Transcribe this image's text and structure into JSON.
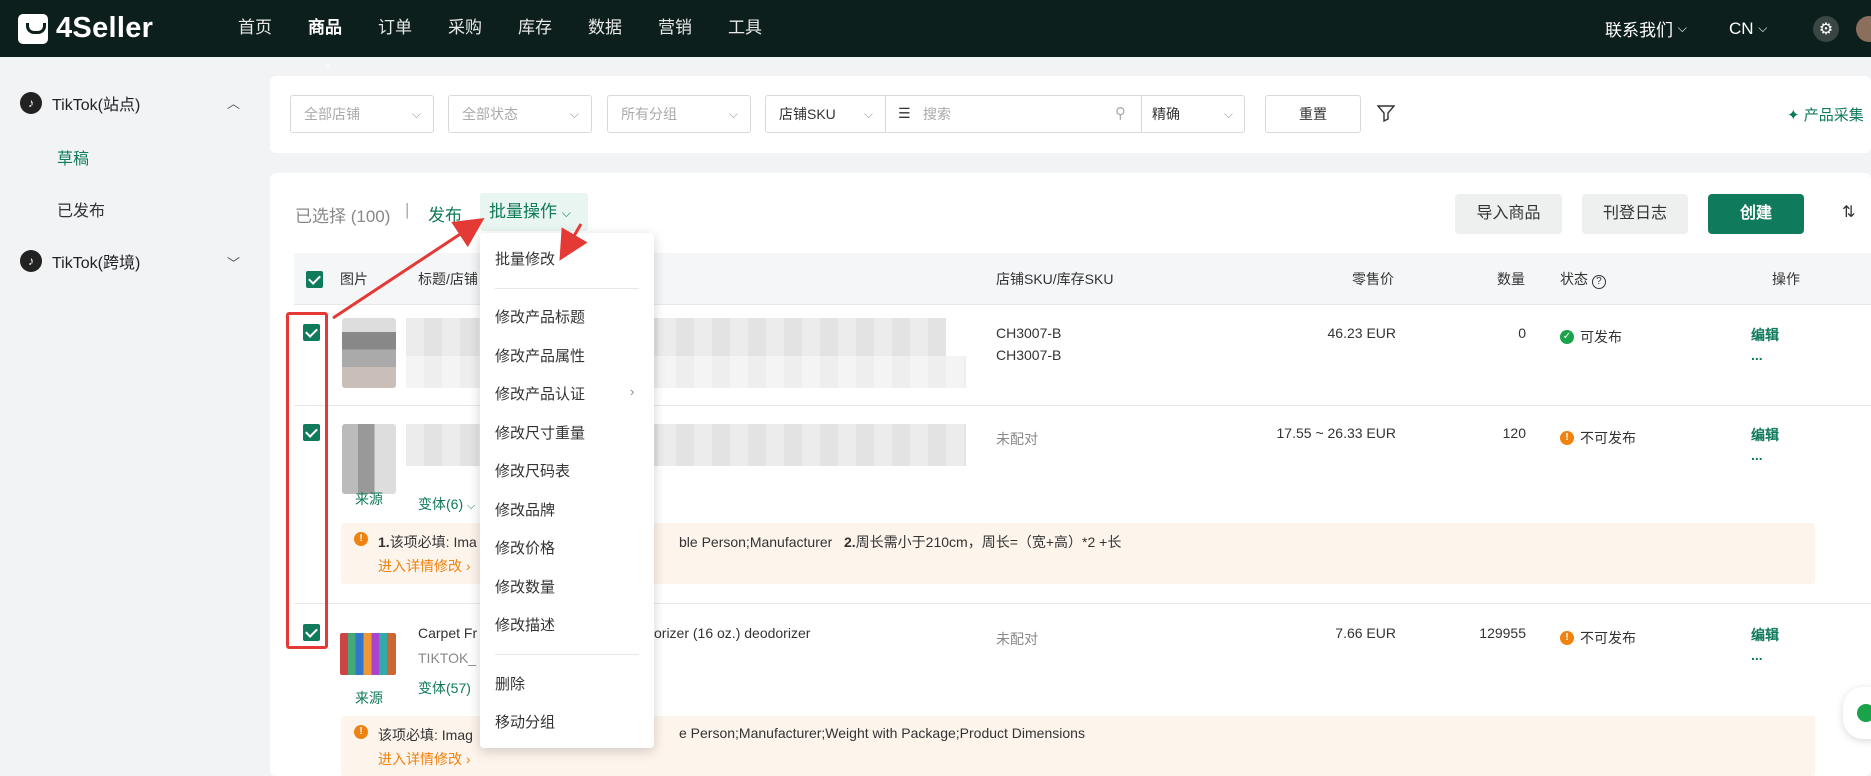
{
  "brand": {
    "name": "4Seller"
  },
  "nav": [
    {
      "label": "首页"
    },
    {
      "label": "商品"
    },
    {
      "label": "订单"
    },
    {
      "label": "采购"
    },
    {
      "label": "库存"
    },
    {
      "label": "数据"
    },
    {
      "label": "营销"
    },
    {
      "label": "工具"
    }
  ],
  "header": {
    "contact": "联系我们",
    "lang": "CN"
  },
  "sidebar": {
    "group1": "TikTok(站点)",
    "items": [
      {
        "label": "草稿"
      },
      {
        "label": "已发布"
      }
    ],
    "group2": "TikTok(跨境)"
  },
  "filters": {
    "store": "全部店铺",
    "status": "全部状态",
    "group": "所有分组",
    "sku_type": "店铺SKU",
    "search_placeholder": "搜索",
    "match": "精确",
    "reset": "重置",
    "collect": "产品采集"
  },
  "toolbar": {
    "selected": "已选择 (100)",
    "publish": "发布",
    "batch": "批量操作",
    "import": "导入商品",
    "log": "刊登日志",
    "create": "创建"
  },
  "table": {
    "headers": {
      "image": "图片",
      "title": "标题/店铺",
      "sku": "店铺SKU/库存SKU",
      "price": "零售价",
      "qty": "数量",
      "status": "状态",
      "action": "操作"
    },
    "rows": [
      {
        "sku1": "CH3007-B",
        "sku2": "CH3007-B",
        "price": "46.23 EUR",
        "qty": "0",
        "status": "可发布",
        "edit": "编辑",
        "more": "..."
      },
      {
        "sku1": "未配对",
        "price": "17.55 ~ 26.33 EUR",
        "qty": "120",
        "status": "不可发布",
        "edit": "编辑",
        "more": "...",
        "source": "来源",
        "variants": "变体(6)",
        "warning": {
          "num1": "1.",
          "part1": "该项必填: Ima",
          "part2": "ble Person;Manufacturer",
          "num2": "2.",
          "part3": "周长需小于210cm，周长=（宽+高）*2 +长",
          "link": "进入详情修改"
        }
      },
      {
        "title_a": "Carpet Fr",
        "title_b": "orizer (16 oz.) deodorizer",
        "store": "TIKTOK_",
        "sku1": "未配对",
        "price": "7.66 EUR",
        "qty": "129955",
        "status": "不可发布",
        "edit": "编辑",
        "more": "...",
        "source": "来源",
        "variants": "变体(57)",
        "warning": {
          "part1": "该项必填: Imag",
          "part2": "e Person;Manufacturer;Weight with Package;Product Dimensions",
          "link": "进入详情修改"
        }
      }
    ]
  },
  "batch_menu": {
    "items": [
      "批量修改",
      "修改产品标题",
      "修改产品属性",
      "修改产品认证",
      "修改尺寸重量",
      "修改尺码表",
      "修改品牌",
      "修改价格",
      "修改数量",
      "修改描述",
      "删除",
      "移动分组"
    ]
  },
  "colors": {
    "accent": "#0f7a5c",
    "topbar": "#0d1f1c",
    "warning": "#f0820f",
    "annotation": "#e53935"
  }
}
